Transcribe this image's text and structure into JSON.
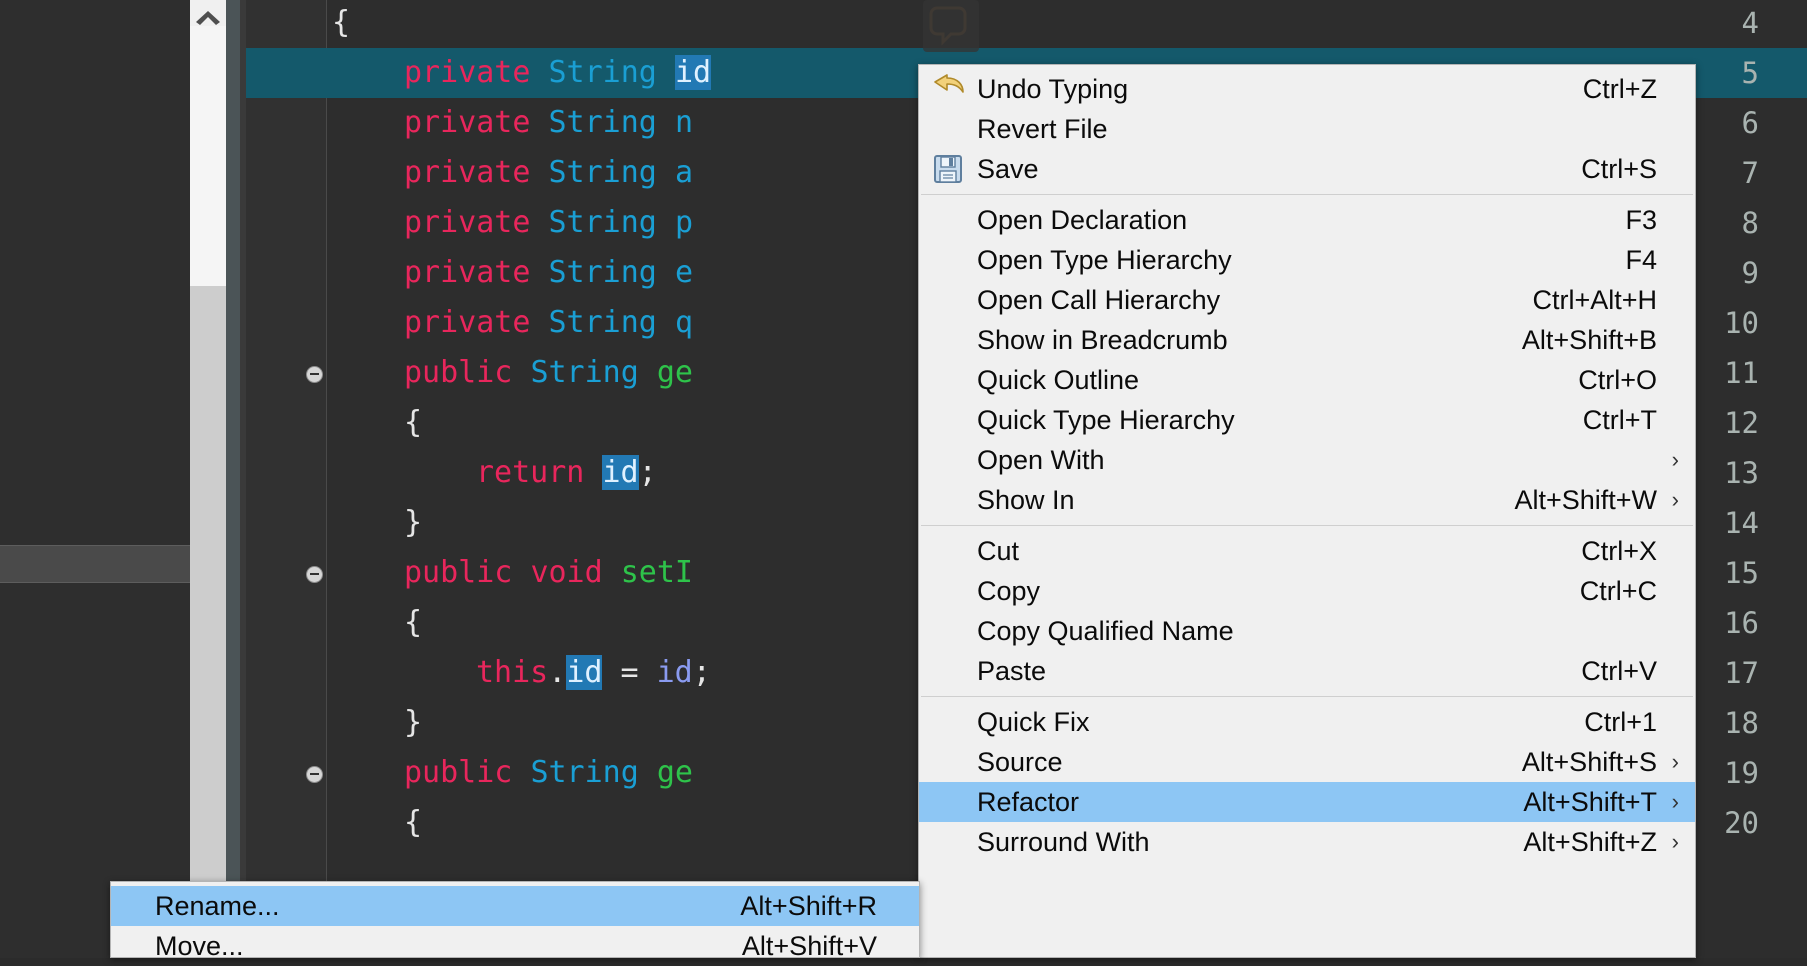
{
  "editor": {
    "language": "java",
    "lines": [
      {
        "num": "4",
        "fold": false,
        "selected": false,
        "tokens": [
          {
            "t": "{",
            "c": "pl"
          }
        ],
        "indent": 0
      },
      {
        "num": "5",
        "fold": false,
        "selected": true,
        "tokens": [
          {
            "t": "private ",
            "c": "kw"
          },
          {
            "t": "String ",
            "c": "ty"
          },
          {
            "t": "id",
            "c": "hl-occ"
          }
        ],
        "indent": 4
      },
      {
        "num": "6",
        "fold": false,
        "selected": false,
        "tokens": [
          {
            "t": "private ",
            "c": "kw"
          },
          {
            "t": "String ",
            "c": "ty"
          },
          {
            "t": "n",
            "c": "ty"
          }
        ],
        "indent": 4
      },
      {
        "num": "7",
        "fold": false,
        "selected": false,
        "tokens": [
          {
            "t": "private ",
            "c": "kw"
          },
          {
            "t": "String ",
            "c": "ty"
          },
          {
            "t": "a",
            "c": "ty"
          }
        ],
        "indent": 4
      },
      {
        "num": "8",
        "fold": false,
        "selected": false,
        "tokens": [
          {
            "t": "private ",
            "c": "kw"
          },
          {
            "t": "String ",
            "c": "ty"
          },
          {
            "t": "p",
            "c": "ty"
          }
        ],
        "indent": 4
      },
      {
        "num": "9",
        "fold": false,
        "selected": false,
        "tokens": [
          {
            "t": "private ",
            "c": "kw"
          },
          {
            "t": "String ",
            "c": "ty"
          },
          {
            "t": "e",
            "c": "ty"
          }
        ],
        "indent": 4
      },
      {
        "num": "10",
        "fold": false,
        "selected": false,
        "tokens": [
          {
            "t": "private ",
            "c": "kw"
          },
          {
            "t": "String ",
            "c": "ty"
          },
          {
            "t": "q",
            "c": "ty"
          }
        ],
        "indent": 4
      },
      {
        "num": "11",
        "fold": true,
        "selected": false,
        "tokens": [
          {
            "t": "public ",
            "c": "kw"
          },
          {
            "t": "String ",
            "c": "ty"
          },
          {
            "t": "ge",
            "c": "mth"
          }
        ],
        "indent": 4
      },
      {
        "num": "12",
        "fold": false,
        "selected": false,
        "tokens": [
          {
            "t": "{",
            "c": "pl"
          }
        ],
        "indent": 4
      },
      {
        "num": "13",
        "fold": false,
        "selected": false,
        "tokens": [
          {
            "t": "return ",
            "c": "kw"
          },
          {
            "t": "id",
            "c": "hl-occ"
          },
          {
            "t": ";",
            "c": "pl"
          }
        ],
        "indent": 8
      },
      {
        "num": "14",
        "fold": false,
        "selected": false,
        "tokens": [
          {
            "t": "}",
            "c": "pl"
          }
        ],
        "indent": 4
      },
      {
        "num": "15",
        "fold": true,
        "selected": false,
        "tokens": [
          {
            "t": "public ",
            "c": "kw"
          },
          {
            "t": "void ",
            "c": "kw"
          },
          {
            "t": "setI",
            "c": "mth"
          }
        ],
        "indent": 4
      },
      {
        "num": "16",
        "fold": false,
        "selected": false,
        "tokens": [
          {
            "t": "{",
            "c": "pl"
          }
        ],
        "indent": 4
      },
      {
        "num": "17",
        "fold": false,
        "selected": false,
        "tokens": [
          {
            "t": "this",
            "c": "kw"
          },
          {
            "t": ".",
            "c": "pl"
          },
          {
            "t": "id",
            "c": "hl-occ"
          },
          {
            "t": " = ",
            "c": "pl"
          },
          {
            "t": "id",
            "c": "par"
          },
          {
            "t": ";",
            "c": "pl"
          }
        ],
        "indent": 8
      },
      {
        "num": "18",
        "fold": false,
        "selected": false,
        "tokens": [
          {
            "t": "}",
            "c": "pl"
          }
        ],
        "indent": 4
      },
      {
        "num": "19",
        "fold": true,
        "selected": false,
        "tokens": [
          {
            "t": "public ",
            "c": "kw"
          },
          {
            "t": "String ",
            "c": "ty"
          },
          {
            "t": "ge",
            "c": "mth"
          }
        ],
        "indent": 4
      },
      {
        "num": "20",
        "fold": false,
        "selected": false,
        "tokens": [
          {
            "t": "{",
            "c": "pl"
          }
        ],
        "indent": 4
      }
    ]
  },
  "colors": {
    "selected_line": "#14596b",
    "occurrence_highlight": "#2279b4",
    "menu_highlight": "#8dc6f4",
    "menu_background": "#f0f0f0",
    "editor_background": "#2d2d2d",
    "keyword": "#e8265c",
    "type": "#1a9fd4",
    "method": "#2ec34a"
  },
  "context_menu": {
    "groups": [
      {
        "items": [
          {
            "label": "Undo Typing",
            "accel": "Ctrl+Z",
            "icon": "undo-icon",
            "submenu": false,
            "highlighted": false
          },
          {
            "label": "Revert File",
            "accel": "",
            "icon": "",
            "submenu": false,
            "highlighted": false
          },
          {
            "label": "Save",
            "accel": "Ctrl+S",
            "icon": "save-icon",
            "submenu": false,
            "highlighted": false
          }
        ]
      },
      {
        "items": [
          {
            "label": "Open Declaration",
            "accel": "F3",
            "icon": "",
            "submenu": false,
            "highlighted": false
          },
          {
            "label": "Open Type Hierarchy",
            "accel": "F4",
            "icon": "",
            "submenu": false,
            "highlighted": false
          },
          {
            "label": "Open Call Hierarchy",
            "accel": "Ctrl+Alt+H",
            "icon": "",
            "submenu": false,
            "highlighted": false
          },
          {
            "label": "Show in Breadcrumb",
            "accel": "Alt+Shift+B",
            "icon": "",
            "submenu": false,
            "highlighted": false
          },
          {
            "label": "Quick Outline",
            "accel": "Ctrl+O",
            "icon": "",
            "submenu": false,
            "highlighted": false
          },
          {
            "label": "Quick Type Hierarchy",
            "accel": "Ctrl+T",
            "icon": "",
            "submenu": false,
            "highlighted": false
          },
          {
            "label": "Open With",
            "accel": "",
            "icon": "",
            "submenu": true,
            "highlighted": false
          },
          {
            "label": "Show In",
            "accel": "Alt+Shift+W",
            "icon": "",
            "submenu": true,
            "highlighted": false
          }
        ]
      },
      {
        "items": [
          {
            "label": "Cut",
            "accel": "Ctrl+X",
            "icon": "",
            "submenu": false,
            "highlighted": false
          },
          {
            "label": "Copy",
            "accel": "Ctrl+C",
            "icon": "",
            "submenu": false,
            "highlighted": false
          },
          {
            "label": "Copy Qualified Name",
            "accel": "",
            "icon": "",
            "submenu": false,
            "highlighted": false
          },
          {
            "label": "Paste",
            "accel": "Ctrl+V",
            "icon": "",
            "submenu": false,
            "highlighted": false
          }
        ]
      },
      {
        "items": [
          {
            "label": "Quick Fix",
            "accel": "Ctrl+1",
            "icon": "",
            "submenu": false,
            "highlighted": false
          },
          {
            "label": "Source",
            "accel": "Alt+Shift+S",
            "icon": "",
            "submenu": true,
            "highlighted": false
          },
          {
            "label": "Refactor",
            "accel": "Alt+Shift+T",
            "icon": "",
            "submenu": true,
            "highlighted": true
          },
          {
            "label": "Surround With",
            "accel": "Alt+Shift+Z",
            "icon": "",
            "submenu": true,
            "highlighted": false
          }
        ]
      }
    ]
  },
  "submenu": {
    "parent": "Refactor",
    "items": [
      {
        "label": "Rename...",
        "accel": "Alt+Shift+R",
        "submenu": false,
        "highlighted": true
      },
      {
        "label": "Move...",
        "accel": "Alt+Shift+V",
        "submenu": false,
        "highlighted": false
      }
    ]
  },
  "scrollbar": {
    "arrow_icon": "chevron-up-icon"
  }
}
